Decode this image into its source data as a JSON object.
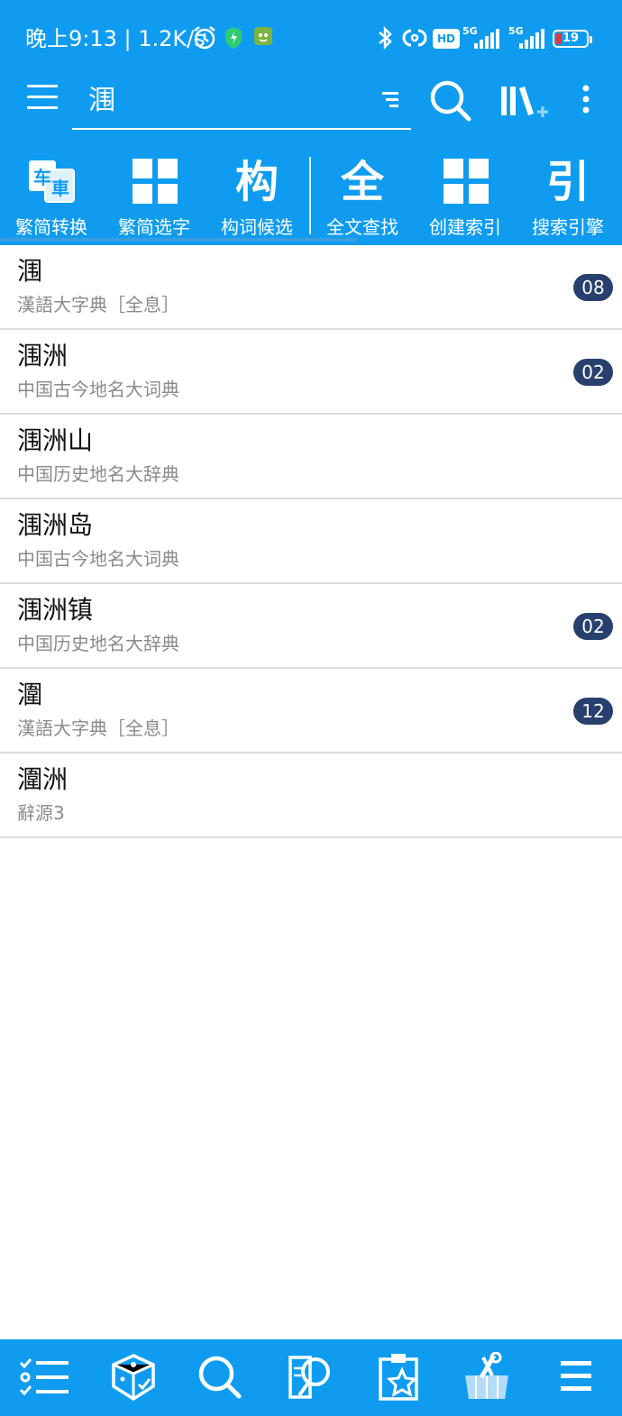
{
  "status_bar": {
    "time": "晚上9:13 | 1.2K/s",
    "hd_label": "HD",
    "network_1": "5G",
    "network_2": "5G",
    "battery": "19",
    "icons": [
      "alarm-icon",
      "shield-icon",
      "app-notification-icon",
      "bluetooth-icon",
      "hotspot-icon",
      "signal-icon",
      "battery-icon"
    ]
  },
  "header": {
    "search_value": "涠",
    "icons": [
      "menu-icon",
      "filter-icon",
      "search-icon",
      "library-add-icon",
      "more-vert-icon"
    ]
  },
  "tools": [
    {
      "label": "繁简转换",
      "glyph": "车車",
      "icon": "trad-simp-convert-icon"
    },
    {
      "label": "繁简选字",
      "icon": "grid-icon"
    },
    {
      "label": "构词候选",
      "glyph": "构",
      "icon": "compose-icon"
    },
    {
      "label": "全文查找",
      "glyph": "全",
      "icon": "fulltext-icon"
    },
    {
      "label": "创建索引",
      "icon": "grid-icon"
    },
    {
      "label": "搜索引擎",
      "glyph": "引",
      "icon": "engine-icon"
    }
  ],
  "results": [
    {
      "word": "涠",
      "source": "漢語大字典［全息］",
      "badge": "08"
    },
    {
      "word": "涠洲",
      "source": "中国古今地名大词典",
      "badge": "02"
    },
    {
      "word": "涠洲山",
      "source": "中国历史地名大辞典",
      "badge": ""
    },
    {
      "word": "涠洲岛",
      "source": "中国古今地名大词典",
      "badge": ""
    },
    {
      "word": "涠洲镇",
      "source": "中国历史地名大辞典",
      "badge": "02"
    },
    {
      "word": "潿",
      "source": "漢語大字典［全息］",
      "badge": "12"
    },
    {
      "word": "潿洲",
      "source": "辭源3",
      "badge": ""
    }
  ],
  "bottom_nav": [
    "checklist-icon",
    "dice-icon",
    "search-icon",
    "book-search-icon",
    "clipboard-star-icon",
    "toolbox-icon",
    "menu-icon"
  ],
  "colors": {
    "primary": "#0f9cf0",
    "badge": "#27406e",
    "source_text": "#8a8a8a",
    "divider": "#dcdcdc"
  }
}
